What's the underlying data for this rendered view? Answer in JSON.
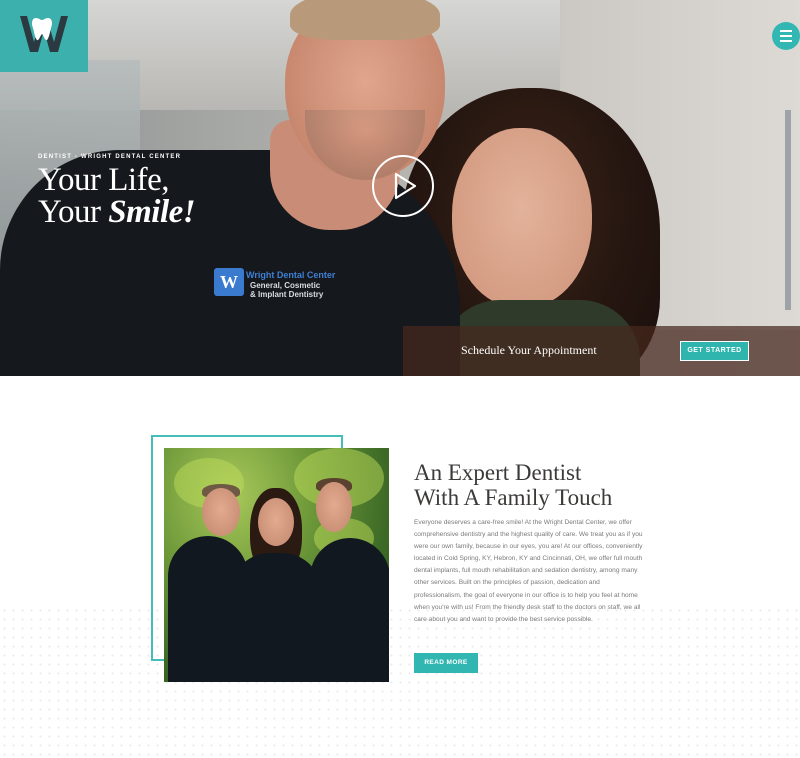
{
  "brand": {
    "icon": "wright-dental-w-tooth-logo",
    "accent": "#3bb0ad"
  },
  "nav": {
    "menu_icon": "hamburger-icon"
  },
  "hero": {
    "eyebrow": "Dentist - Wright Dental Center",
    "title_line1": "Your Life,",
    "title_line2_prefix": "Your ",
    "title_line2_em": "Smile!",
    "play_icon": "play-icon",
    "shirt_logo_line1": "Wright Dental Center",
    "shirt_logo_line2": "General, Cosmetic",
    "shirt_logo_line3": "& Implant Dentistry"
  },
  "schedule": {
    "label": "Schedule Your Appointment",
    "button": "GET STARTED"
  },
  "about": {
    "title_line1": "An Expert Dentist",
    "title_line2": "With A Family Touch",
    "body": "Everyone deserves a care-free smile! At the Wright Dental Center, we offer comprehensive dentistry and the highest quality of care. We treat you as if you were our own family, because in our eyes, you are! At our offices, conveniently located in Cold Spring, KY, Hebron, KY and Cincinnati, OH, we offer full mouth dental implants, full mouth rehabilitation and sedation dentistry, among many other services. Built on the principles of passion, dedication and professionalism, the goal of everyone in our office  is to help you feel at home when you're with us! From the friendly desk staff to the doctors on staff, we all care about you and want to provide the best service possible.",
    "button": "READ MORE"
  }
}
